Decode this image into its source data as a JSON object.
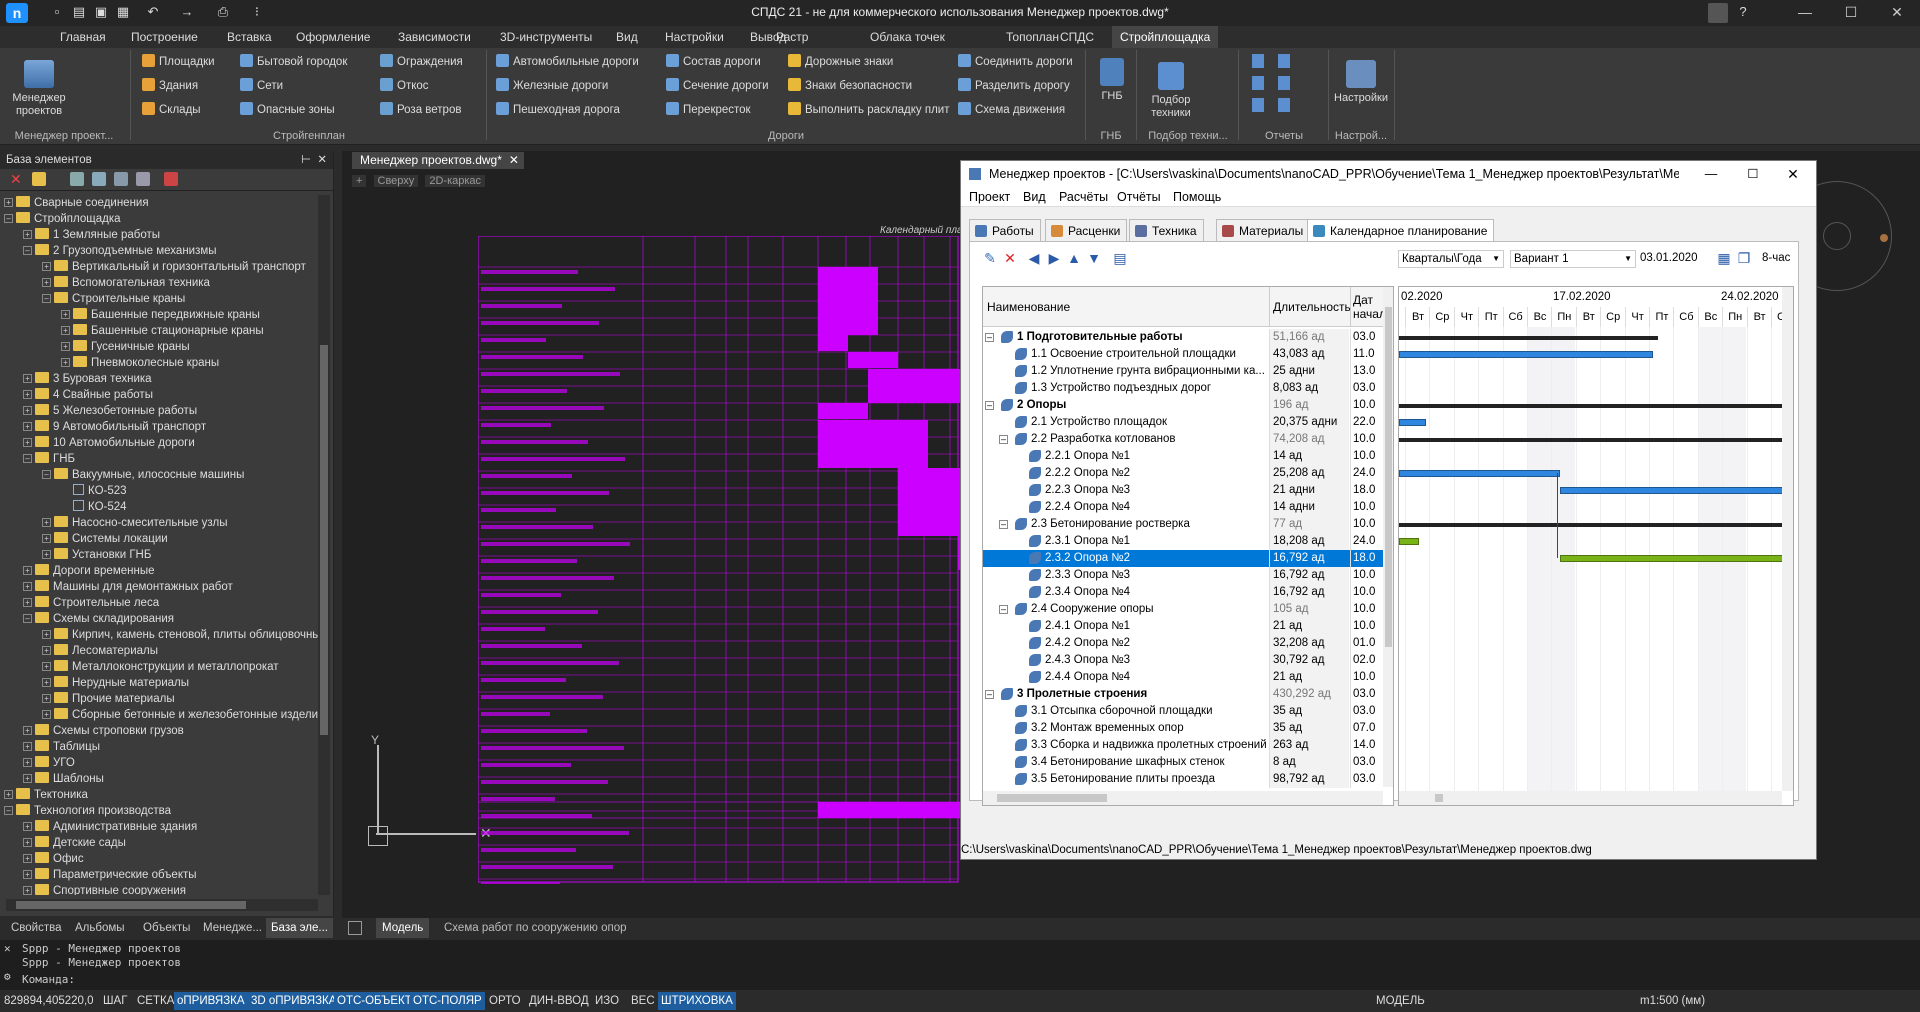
{
  "titlebar": {
    "title": "СПДС 21 - не для коммерческого использования Менеджер проектов.dwg*"
  },
  "ribbon_tabs": [
    "Главная",
    "Построение",
    "Вставка",
    "Оформление",
    "Зависимости",
    "3D-инструменты",
    "Вид",
    "Настройки",
    "Вывод",
    "Растр",
    "Облака точек",
    "Топоплан",
    "СПДС",
    "Стройплощадка"
  ],
  "ribbon": {
    "big_buttons": {
      "manager": "Менеджер проектов",
      "gnb": "ГНБ",
      "tech": "Подбор техники",
      "settings": "Настройки"
    },
    "col1": [
      "Площадки",
      "Здания",
      "Склады"
    ],
    "col2": [
      "Бытовой городок",
      "Сети",
      "Опасные зоны"
    ],
    "col3": [
      "Ограждения",
      "Откос",
      "Роза ветров"
    ],
    "col4": [
      "Автомобильные дороги",
      "Железные дороги",
      "Пешеходная дорога"
    ],
    "col5": [
      "Состав дороги",
      "Сечение дороги",
      "Перекресток"
    ],
    "col6": [
      "Дорожные знаки",
      "Знаки безопасности",
      "Выполнить раскладку плит"
    ],
    "col7": [
      "Соединить дороги",
      "Разделить дорогу",
      "Схема движения"
    ],
    "groups": [
      "Менеджер проект...",
      "Стройгенплан",
      "Дороги",
      "ГНБ",
      "Подбор техни...",
      "Отчеты",
      "Настрой..."
    ]
  },
  "left_panel": {
    "title": "База элементов",
    "tree": [
      {
        "label": "Сварные соединения",
        "level": 1,
        "exp": "+",
        "type": "folder"
      },
      {
        "label": "Стройплощадка",
        "level": 1,
        "exp": "-",
        "type": "folder"
      },
      {
        "label": "1 Земляные работы",
        "level": 2,
        "exp": "+",
        "type": "folder"
      },
      {
        "label": "2 Грузоподъемные механизмы",
        "level": 2,
        "exp": "-",
        "type": "folder"
      },
      {
        "label": "Вертикальный и горизонтальный транспорт",
        "level": 3,
        "exp": "+",
        "type": "folder"
      },
      {
        "label": "Вспомогательная техника",
        "level": 3,
        "exp": "+",
        "type": "folder"
      },
      {
        "label": "Строительные краны",
        "level": 3,
        "exp": "-",
        "type": "folder"
      },
      {
        "label": "Башенные передвижные краны",
        "level": 4,
        "exp": "+",
        "type": "folder"
      },
      {
        "label": "Башенные стационарные краны",
        "level": 4,
        "exp": "+",
        "type": "folder"
      },
      {
        "label": "Гусеничные краны",
        "level": 4,
        "exp": "+",
        "type": "folder"
      },
      {
        "label": "Пневмоколесные краны",
        "level": 4,
        "exp": "+",
        "type": "folder"
      },
      {
        "label": "3 Буровая техника",
        "level": 2,
        "exp": "+",
        "type": "folder"
      },
      {
        "label": "4 Свайные работы",
        "level": 2,
        "exp": "+",
        "type": "folder"
      },
      {
        "label": "5 Железобетонные работы",
        "level": 2,
        "exp": "+",
        "type": "folder"
      },
      {
        "label": "9 Автомобильный транспорт",
        "level": 2,
        "exp": "+",
        "type": "folder"
      },
      {
        "label": "10 Автомобильные дороги",
        "level": 2,
        "exp": "+",
        "type": "folder"
      },
      {
        "label": "ГНБ",
        "level": 2,
        "exp": "-",
        "type": "folder"
      },
      {
        "label": "Вакуумные, илососные машины",
        "level": 3,
        "exp": "-",
        "type": "folder"
      },
      {
        "label": "КО-523",
        "level": 4,
        "exp": "",
        "type": "block"
      },
      {
        "label": "КО-524",
        "level": 4,
        "exp": "",
        "type": "block"
      },
      {
        "label": "Насосно-смесительные узлы",
        "level": 3,
        "exp": "+",
        "type": "folder"
      },
      {
        "label": "Системы локации",
        "level": 3,
        "exp": "+",
        "type": "folder"
      },
      {
        "label": "Установки ГНБ",
        "level": 3,
        "exp": "+",
        "type": "folder"
      },
      {
        "label": "Дороги временные",
        "level": 2,
        "exp": "+",
        "type": "folder"
      },
      {
        "label": "Машины для демонтажных работ",
        "level": 2,
        "exp": "+",
        "type": "folder"
      },
      {
        "label": "Строительные леса",
        "level": 2,
        "exp": "+",
        "type": "folder"
      },
      {
        "label": "Схемы складирования",
        "level": 2,
        "exp": "-",
        "type": "folder"
      },
      {
        "label": "Кирпич, камень стеновой, плиты облицовочные",
        "level": 3,
        "exp": "+",
        "type": "folder"
      },
      {
        "label": "Лесоматериалы",
        "level": 3,
        "exp": "+",
        "type": "folder"
      },
      {
        "label": "Металлоконструкции и металлопрокат",
        "level": 3,
        "exp": "+",
        "type": "folder"
      },
      {
        "label": "Нерудные материалы",
        "level": 3,
        "exp": "+",
        "type": "folder"
      },
      {
        "label": "Прочие материалы",
        "level": 3,
        "exp": "+",
        "type": "folder"
      },
      {
        "label": "Сборные бетонные и железобетонные изделия",
        "level": 3,
        "exp": "+",
        "type": "folder"
      },
      {
        "label": "Схемы строповки грузов",
        "level": 2,
        "exp": "+",
        "type": "folder"
      },
      {
        "label": "Таблицы",
        "level": 2,
        "exp": "+",
        "type": "folder"
      },
      {
        "label": "УГО",
        "level": 2,
        "exp": "+",
        "type": "folder"
      },
      {
        "label": "Шаблоны",
        "level": 2,
        "exp": "+",
        "type": "folder"
      },
      {
        "label": "Тектоника",
        "level": 1,
        "exp": "+",
        "type": "folder"
      },
      {
        "label": "Технология производства",
        "level": 1,
        "exp": "-",
        "type": "folder"
      },
      {
        "label": "Административные здания",
        "level": 2,
        "exp": "+",
        "type": "folder"
      },
      {
        "label": "Детские сады",
        "level": 2,
        "exp": "+",
        "type": "folder"
      },
      {
        "label": "Офис",
        "level": 2,
        "exp": "+",
        "type": "folder"
      },
      {
        "label": "Параметрические объекты",
        "level": 2,
        "exp": "+",
        "type": "folder"
      },
      {
        "label": "Спортивные сооружения",
        "level": 2,
        "exp": "+",
        "type": "folder"
      }
    ],
    "bottom_tabs": [
      "Свойства",
      "Альбомы",
      "Объекты",
      "Менедже...",
      "База эле..."
    ]
  },
  "doc": {
    "tab": "Менеджер проектов.dwg*",
    "view_controls": [
      "+",
      "Сверху",
      "2D-каркас"
    ],
    "drawing_title": "Календарный план г",
    "model_tabs": [
      "Модель",
      "Схема работ по сооружению опор"
    ]
  },
  "pm": {
    "title": "Менеджер проектов - [C:\\Users\\vaskina\\Documents\\nanoCAD_PPR\\Обучение\\Тема 1_Менеджер проектов\\Результат\\Мене...",
    "menu": [
      "Проект",
      "Вид",
      "Расчёты",
      "Отчёты",
      "Помощь"
    ],
    "tabs": [
      "Работы",
      "Расценки",
      "Техника",
      "Материалы",
      "Календарное планирование"
    ],
    "scale_select": "Кварталы\\Года",
    "variant_select": "Вариант 1",
    "date_value": "03.01.2020",
    "hours_value": "8-час",
    "col_name": "Наименование",
    "col_dur": "Длительность",
    "col_date": "Дат начало",
    "rows": [
      {
        "name": "1 Подготовительные работы",
        "dur": "51,166 ад",
        "date": "03.0",
        "level": 0,
        "exp": "-",
        "bold": true,
        "grey": true
      },
      {
        "name": "1.1 Освоение строительной площадки",
        "dur": "43,083 ад",
        "date": "11.0",
        "level": 1,
        "exp": "",
        "bold": false,
        "grey": false
      },
      {
        "name": "1.2 Уплотнение грунта вибрационными ка...",
        "dur": "25 адни",
        "date": "13.0",
        "level": 1,
        "exp": "",
        "bold": false,
        "grey": false
      },
      {
        "name": "1.3 Устройство подъездных дорог",
        "dur": "8,083 ад",
        "date": "03.0",
        "level": 1,
        "exp": "",
        "bold": false,
        "grey": false
      },
      {
        "name": "2 Опоры",
        "dur": "196 ад",
        "date": "10.0",
        "level": 0,
        "exp": "-",
        "bold": true,
        "grey": true
      },
      {
        "name": "2.1 Устройство площадок",
        "dur": "20,375 адни",
        "date": "22.0",
        "level": 1,
        "exp": "",
        "bold": false,
        "grey": false
      },
      {
        "name": "2.2 Разработка котлованов",
        "dur": "74,208 ад",
        "date": "10.0",
        "level": 1,
        "exp": "-",
        "bold": false,
        "grey": true
      },
      {
        "name": "2.2.1 Опора №1",
        "dur": "14 ад",
        "date": "10.0",
        "level": 2,
        "exp": "",
        "bold": false,
        "grey": false
      },
      {
        "name": "2.2.2 Опора №2",
        "dur": "25,208 ад",
        "date": "24.0",
        "level": 2,
        "exp": "",
        "bold": false,
        "grey": false
      },
      {
        "name": "2.2.3 Опора №3",
        "dur": "21 адни",
        "date": "18.0",
        "level": 2,
        "exp": "",
        "bold": false,
        "grey": false
      },
      {
        "name": "2.2.4 Опора №4",
        "dur": "14 адни",
        "date": "10.0",
        "level": 2,
        "exp": "",
        "bold": false,
        "grey": false
      },
      {
        "name": "2.3 Бетонирование ростверка",
        "dur": "77 ад",
        "date": "10.0",
        "level": 1,
        "exp": "-",
        "bold": false,
        "grey": true
      },
      {
        "name": "2.3.1 Опора №1",
        "dur": "18,208 ад",
        "date": "24.0",
        "level": 2,
        "exp": "",
        "bold": false,
        "grey": false
      },
      {
        "name": "2.3.2 Опора №2",
        "dur": "16,792 ад",
        "date": "18.0",
        "level": 2,
        "exp": "",
        "bold": false,
        "grey": false,
        "sel": true
      },
      {
        "name": "2.3.3 Опора №3",
        "dur": "16,792 ад",
        "date": "10.0",
        "level": 2,
        "exp": "",
        "bold": false,
        "grey": false
      },
      {
        "name": "2.3.4 Опора №4",
        "dur": "16,792 ад",
        "date": "10.0",
        "level": 2,
        "exp": "",
        "bold": false,
        "grey": false
      },
      {
        "name": "2.4 Сооружение опоры",
        "dur": "105 ад",
        "date": "10.0",
        "level": 1,
        "exp": "-",
        "bold": false,
        "grey": true
      },
      {
        "name": "2.4.1 Опора №1",
        "dur": "21 ад",
        "date": "10.0",
        "level": 2,
        "exp": "",
        "bold": false,
        "grey": false
      },
      {
        "name": "2.4.2 Опора №2",
        "dur": "32,208 ад",
        "date": "01.0",
        "level": 2,
        "exp": "",
        "bold": false,
        "grey": false
      },
      {
        "name": "2.4.3 Опора №3",
        "dur": "30,792 ад",
        "date": "02.0",
        "level": 2,
        "exp": "",
        "bold": false,
        "grey": false
      },
      {
        "name": "2.4.4 Опора №4",
        "dur": "21 ад",
        "date": "10.0",
        "level": 2,
        "exp": "",
        "bold": false,
        "grey": false
      },
      {
        "name": "3 Пролетные строения",
        "dur": "430,292 ад",
        "date": "03.0",
        "level": 0,
        "exp": "-",
        "bold": true,
        "grey": true
      },
      {
        "name": "3.1 Отсыпка сборочной площадки",
        "dur": "35 ад",
        "date": "03.0",
        "level": 1,
        "exp": "",
        "bold": false,
        "grey": false
      },
      {
        "name": "3.2 Монтаж временных опор",
        "dur": "35 ад",
        "date": "07.0",
        "level": 1,
        "exp": "",
        "bold": false,
        "grey": false
      },
      {
        "name": "3.3 Сборка и надвижка пролетных строений",
        "dur": "263 ад",
        "date": "14.0",
        "level": 1,
        "exp": "",
        "bold": false,
        "grey": false
      },
      {
        "name": "3.4 Бетонирование шкафных стенок",
        "dur": "8 ад",
        "date": "03.0",
        "level": 1,
        "exp": "",
        "bold": false,
        "grey": false
      },
      {
        "name": "3.5 Бетонирование плиты проезда",
        "dur": "98,792 ад",
        "date": "03.0",
        "level": 1,
        "exp": "",
        "bold": false,
        "grey": false
      }
    ],
    "weeks": [
      "02.2020",
      "17.02.2020",
      "24.02.2020"
    ],
    "days": [
      "Вт",
      "Ср",
      "Чт",
      "Пт",
      "Сб",
      "Вс",
      "Пн",
      "Вт",
      "Ср",
      "Чт",
      "Пт",
      "Сб",
      "Вс",
      "Пн",
      "Вт",
      "Ср"
    ],
    "status_path": "C:\\Users\\vaskina\\Documents\\nanoCAD_PPR\\Обучение\\Тема 1_Менеджер проектов\\Результат\\Менеджер проектов.dwg"
  },
  "command": {
    "lines": [
      "Sppp - Менеджер проектов",
      "Sppp - Менеджер проектов"
    ],
    "prompt": "Команда:"
  },
  "statusbar": {
    "coords": "829894,405220,0",
    "toggles": [
      {
        "label": "ШАГ",
        "on": false
      },
      {
        "label": "СЕТКА",
        "on": false
      },
      {
        "label": "оПРИВЯЗКА",
        "on": true
      },
      {
        "label": "3D оПРИВЯЗКА",
        "on": true
      },
      {
        "label": "ОТС-ОБЪЕКТ",
        "on": true
      },
      {
        "label": "ОТС-ПОЛЯР",
        "on": true
      },
      {
        "label": "ОРТО",
        "on": false
      },
      {
        "label": "ДИН-ВВОД",
        "on": false
      },
      {
        "label": "ИЗО",
        "on": false
      },
      {
        "label": "ВЕС",
        "on": false
      },
      {
        "label": "ШТРИХОВКА",
        "on": true
      }
    ],
    "model": "МОДЕЛЬ",
    "scale": "m1:500 (мм)"
  },
  "colors": {
    "accent": "#0078d7",
    "drawing": "#cc00ff",
    "bar_blue": "#2e86de",
    "bar_green": "#7ab317"
  }
}
